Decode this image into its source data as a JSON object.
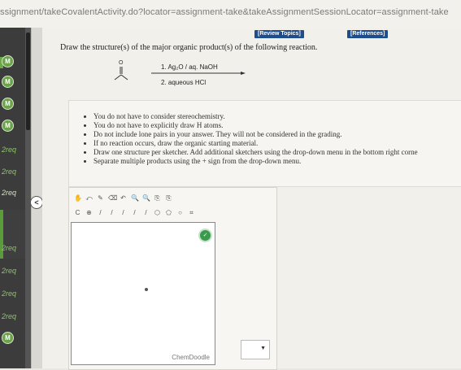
{
  "browser": {
    "url": "ssignment/takeCovalentActivity.do?locator=assignment-take&takeAssignmentSessionLocator=assignment-take"
  },
  "sidebar": {
    "items": [
      {
        "type": "badge",
        "label": "M"
      },
      {
        "type": "badge",
        "label": "M"
      },
      {
        "type": "badge",
        "label": "M"
      },
      {
        "type": "badge",
        "label": "M"
      },
      {
        "type": "req",
        "label": "2req"
      },
      {
        "type": "req",
        "label": "2req"
      },
      {
        "type": "req",
        "label": "2req"
      },
      {
        "type": "req",
        "label": "2req"
      },
      {
        "type": "req",
        "label": "2req"
      },
      {
        "type": "req",
        "label": "2req"
      },
      {
        "type": "req",
        "label": "2req"
      },
      {
        "type": "badge",
        "label": "M"
      }
    ],
    "collapse_label": "<"
  },
  "header": {
    "review_topics": "[Review Topics]",
    "references": "[References]"
  },
  "question": {
    "prompt": "Draw the structure(s) of the major organic product(s) of the following reaction.",
    "reagent_1": "1. Ag₂O / aq. NaOH",
    "reagent_2": "2. aqueous HCl",
    "notes": [
      "You do not have to consider stereochemistry.",
      "You do not have to explicitly draw H atoms.",
      "Do not include lone pairs in your answer. They will not be considered in the grading.",
      "If no reaction occurs, draw the organic starting material.",
      "Draw one structure per sketcher. Add additional sketchers using the drop-down menu in the bottom right corne",
      "Separate multiple products using the + sign from the drop-down menu."
    ]
  },
  "sketcher": {
    "brand": "ChemDoodle",
    "dropdown_value": "",
    "toolbar_row1": [
      "✋",
      "⤺",
      "✎",
      "⌫",
      "↶",
      "🔍",
      "🔍",
      "⎘",
      "⎘"
    ],
    "toolbar_row2": [
      "C",
      "⊕",
      "/",
      "/",
      "/",
      "/",
      "/",
      "⬡",
      "⬠",
      "○",
      "⌗"
    ]
  },
  "colors": {
    "sidebar_bg": "#3c3c3c",
    "badge_green": "#6ba34a",
    "header_blue": "#1e4d8c",
    "go_button": "#3a9b4c"
  }
}
